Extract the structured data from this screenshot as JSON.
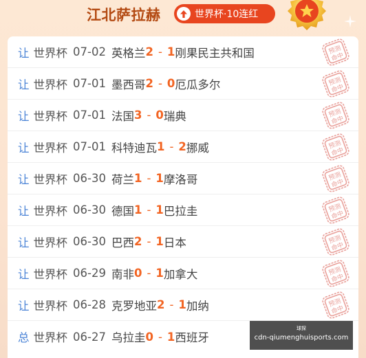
{
  "header": {
    "expert_name": "江北萨拉赫",
    "streak_label": "世界杯·10连红",
    "icon": "up-arrow-icon"
  },
  "colors": {
    "accent": "#e8451f",
    "score": "#f26422",
    "tag": "#4a83d6",
    "stamp": "#e9a09a"
  },
  "stamp_text": [
    "预测",
    "命中"
  ],
  "matches": [
    {
      "tag": "让",
      "league": "世界杯",
      "date": "07-02",
      "home": "英格兰",
      "home_score": "2",
      "away_score": "1",
      "away": "刚果民主共和国"
    },
    {
      "tag": "让",
      "league": "世界杯",
      "date": "07-01",
      "home": "墨西哥",
      "home_score": "2",
      "away_score": "0",
      "away": "厄瓜多尔"
    },
    {
      "tag": "让",
      "league": "世界杯",
      "date": "07-01",
      "home": "法国",
      "home_score": "3",
      "away_score": "0",
      "away": "瑞典"
    },
    {
      "tag": "让",
      "league": "世界杯",
      "date": "07-01",
      "home": "科特迪瓦",
      "home_score": "1",
      "away_score": "2",
      "away": "挪威"
    },
    {
      "tag": "让",
      "league": "世界杯",
      "date": "06-30",
      "home": "荷兰",
      "home_score": "1",
      "away_score": "1",
      "away": "摩洛哥"
    },
    {
      "tag": "让",
      "league": "世界杯",
      "date": "06-30",
      "home": "德国",
      "home_score": "1",
      "away_score": "1",
      "away": "巴拉圭"
    },
    {
      "tag": "让",
      "league": "世界杯",
      "date": "06-30",
      "home": "巴西",
      "home_score": "2",
      "away_score": "1",
      "away": "日本"
    },
    {
      "tag": "让",
      "league": "世界杯",
      "date": "06-29",
      "home": "南非",
      "home_score": "0",
      "away_score": "1",
      "away": "加拿大"
    },
    {
      "tag": "让",
      "league": "世界杯",
      "date": "06-28",
      "home": "克罗地亚",
      "home_score": "2",
      "away_score": "1",
      "away": "加纳"
    },
    {
      "tag": "总",
      "league": "世界杯",
      "date": "06-27",
      "home": "乌拉圭",
      "home_score": "0",
      "away_score": "1",
      "away": "西班牙"
    }
  ],
  "watermark": {
    "top": "球探",
    "url": "cdn-qiumenghuisports.com"
  }
}
